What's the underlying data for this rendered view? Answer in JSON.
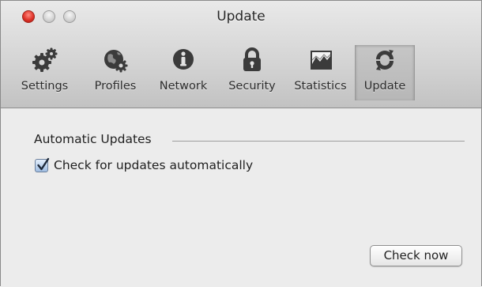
{
  "window": {
    "title": "Update"
  },
  "toolbar": {
    "items": [
      {
        "label": "Settings",
        "icon": "gears-icon"
      },
      {
        "label": "Profiles",
        "icon": "globe-gear-icon"
      },
      {
        "label": "Network",
        "icon": "info-icon"
      },
      {
        "label": "Security",
        "icon": "lock-icon"
      },
      {
        "label": "Statistics",
        "icon": "chart-icon"
      },
      {
        "label": "Update",
        "icon": "refresh-icon",
        "selected": true
      }
    ]
  },
  "content": {
    "section_title": "Automatic Updates",
    "auto_update": {
      "label": "Check for updates automatically",
      "checked": true
    },
    "check_now_label": "Check now"
  }
}
